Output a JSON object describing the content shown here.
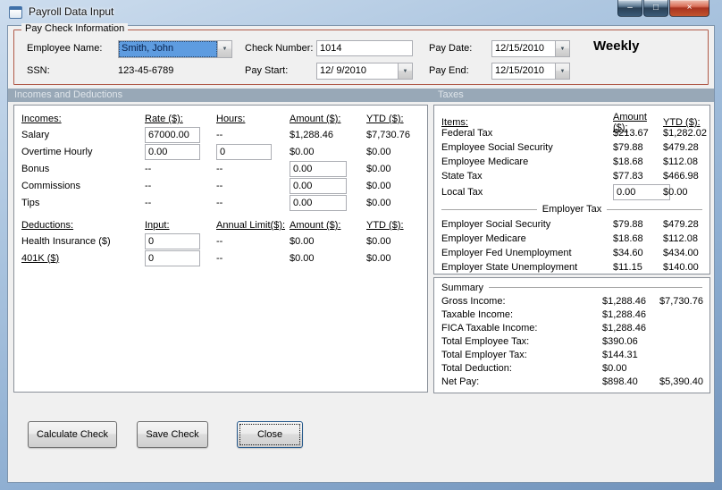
{
  "window": {
    "title": "Payroll Data Input"
  },
  "icons": {
    "minimize": "–",
    "maximize": "□",
    "close": "×",
    "dropdown": "▼"
  },
  "colors": {
    "band": "#98a8b7",
    "group_border": "#b05a49",
    "selection": "#5e9ce0"
  },
  "paycheck": {
    "legend": "Pay Check Information",
    "employee_name": {
      "label": "Employee Name:",
      "value": "Smith, John"
    },
    "ssn": {
      "label": "SSN:",
      "value": "123-45-6789"
    },
    "check_number": {
      "label": "Check Number:",
      "value": "1014"
    },
    "pay_start": {
      "label": "Pay Start:",
      "value": "12/ 9/2010"
    },
    "pay_date": {
      "label": "Pay Date:",
      "value": "12/15/2010"
    },
    "pay_end": {
      "label": "Pay End:",
      "value": "12/15/2010"
    },
    "frequency": "Weekly"
  },
  "sections": {
    "incomes_deductions": "Incomes and Deductions",
    "taxes": "Taxes"
  },
  "incomes": {
    "headers": {
      "name": "Incomes:",
      "rate": "Rate ($):",
      "hours": "Hours:",
      "amount": "Amount ($):",
      "ytd": "YTD ($):"
    },
    "rows": [
      {
        "label": "Salary",
        "rate": "67000.00",
        "hours": "--",
        "amount": "$1,288.46",
        "ytd": "$7,730.76"
      },
      {
        "label": "Overtime Hourly",
        "rate": "0.00",
        "hours": "0",
        "amount": "$0.00",
        "ytd": "$0.00"
      },
      {
        "label": "Bonus",
        "rate": "--",
        "hours": "--",
        "amount": "0.00",
        "ytd": "$0.00"
      },
      {
        "label": "Commissions",
        "rate": "--",
        "hours": "--",
        "amount": "0.00",
        "ytd": "$0.00"
      },
      {
        "label": "Tips",
        "rate": "--",
        "hours": "--",
        "amount": "0.00",
        "ytd": "$0.00"
      }
    ]
  },
  "deductions": {
    "headers": {
      "name": "Deductions:",
      "input": "Input:",
      "limit": "Annual Limit($):",
      "amount": "Amount ($):",
      "ytd": "YTD ($):"
    },
    "rows": [
      {
        "label": "Health Insurance ($)",
        "input": "0",
        "limit": "--",
        "amount": "$0.00",
        "ytd": "$0.00"
      },
      {
        "label": "401K ($)",
        "input": "0",
        "limit": "--",
        "amount": "$0.00",
        "ytd": "$0.00"
      }
    ]
  },
  "taxes": {
    "headers": {
      "items": "Items:",
      "amount": "Amount ($):",
      "ytd": "YTD ($):"
    },
    "employee_rows": [
      {
        "label": "Federal Tax",
        "amount": "$213.67",
        "ytd": "$1,282.02"
      },
      {
        "label": "Employee Social Security",
        "amount": "$79.88",
        "ytd": "$479.28"
      },
      {
        "label": "Employee Medicare",
        "amount": "$18.68",
        "ytd": "$112.08"
      },
      {
        "label": "State Tax",
        "amount": "$77.83",
        "ytd": "$466.98"
      },
      {
        "label": "Local Tax",
        "amount": "0.00",
        "ytd": "$0.00"
      }
    ],
    "employer_header": "Employer Tax",
    "employer_rows": [
      {
        "label": "Employer Social Security",
        "amount": "$79.88",
        "ytd": "$479.28"
      },
      {
        "label": "Employer Medicare",
        "amount": "$18.68",
        "ytd": "$112.08"
      },
      {
        "label": "Employer Fed Unemployment",
        "amount": "$34.60",
        "ytd": "$434.00"
      },
      {
        "label": "Employer State Unemployment",
        "amount": "$11.15",
        "ytd": "$140.00"
      }
    ]
  },
  "summary": {
    "title": "Summary",
    "rows": [
      {
        "label": "Gross Income:",
        "amount": "$1,288.46",
        "ytd": "$7,730.76"
      },
      {
        "label": "Taxable Income:",
        "amount": "$1,288.46",
        "ytd": ""
      },
      {
        "label": "FICA Taxable Income:",
        "amount": "$1,288.46",
        "ytd": ""
      },
      {
        "label": "Total Employee Tax:",
        "amount": "$390.06",
        "ytd": ""
      },
      {
        "label": "Total Employer Tax:",
        "amount": "$144.31",
        "ytd": ""
      },
      {
        "label": "Total Deduction:",
        "amount": "$0.00",
        "ytd": ""
      },
      {
        "label": "Net Pay:",
        "amount": "$898.40",
        "ytd": "$5,390.40"
      }
    ]
  },
  "buttons": {
    "calculate": "Calculate Check",
    "save": "Save Check",
    "close": "Close"
  }
}
